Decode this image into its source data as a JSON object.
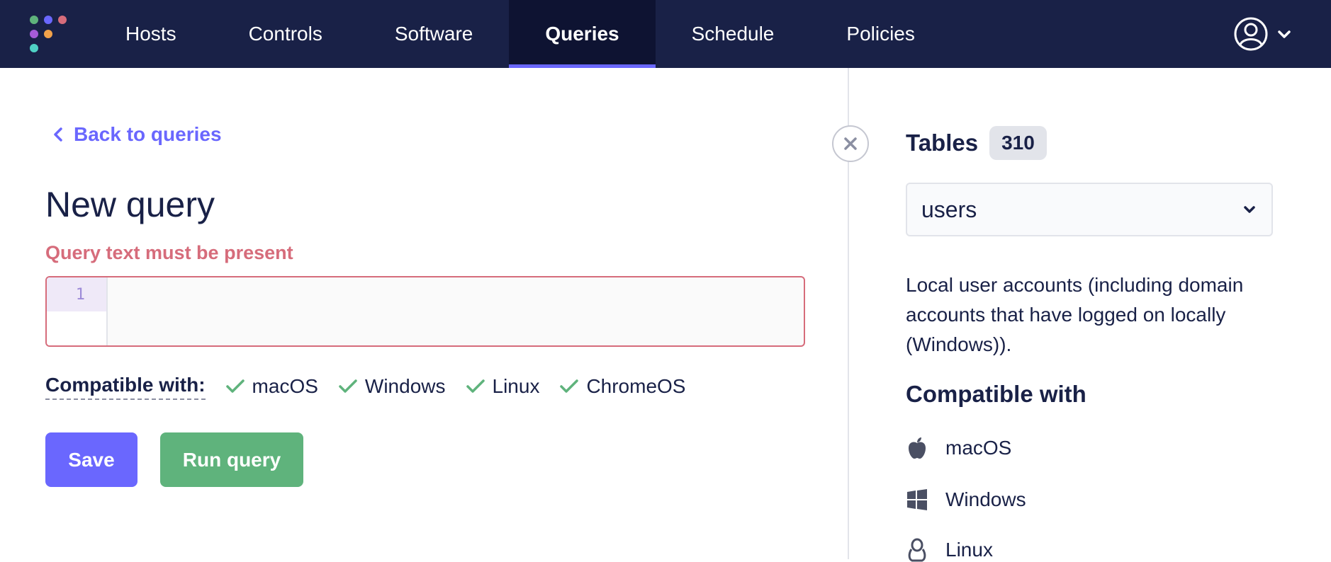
{
  "nav": {
    "tabs": [
      {
        "label": "Hosts"
      },
      {
        "label": "Controls"
      },
      {
        "label": "Software"
      },
      {
        "label": "Queries",
        "active": true
      },
      {
        "label": "Schedule"
      },
      {
        "label": "Policies"
      }
    ],
    "user_icon": "user-circle-icon",
    "user_menu_icon": "chevron-down-icon"
  },
  "query": {
    "back_label": "Back to queries",
    "title": "New query",
    "error": "Query text must be present",
    "editor_line": "1",
    "compatible_label": "Compatible with:",
    "compatible_platforms": [
      "macOS",
      "Windows",
      "Linux",
      "ChromeOS"
    ],
    "save_label": "Save",
    "run_label": "Run query"
  },
  "sidebar": {
    "tables_title": "Tables",
    "tables_count": "310",
    "selected_table": "users",
    "description": "Local user accounts (including domain accounts that have logged on locally (Windows)).",
    "compatible_heading": "Compatible with",
    "platforms": [
      {
        "label": "macOS",
        "icon": "apple-icon"
      },
      {
        "label": "Windows",
        "icon": "windows-icon"
      },
      {
        "label": "Linux",
        "icon": "linux-icon"
      }
    ]
  },
  "colors": {
    "nav_bg": "#192147",
    "accent": "#6a67fe",
    "error": "#d66c7b",
    "success": "#5fb37c"
  }
}
